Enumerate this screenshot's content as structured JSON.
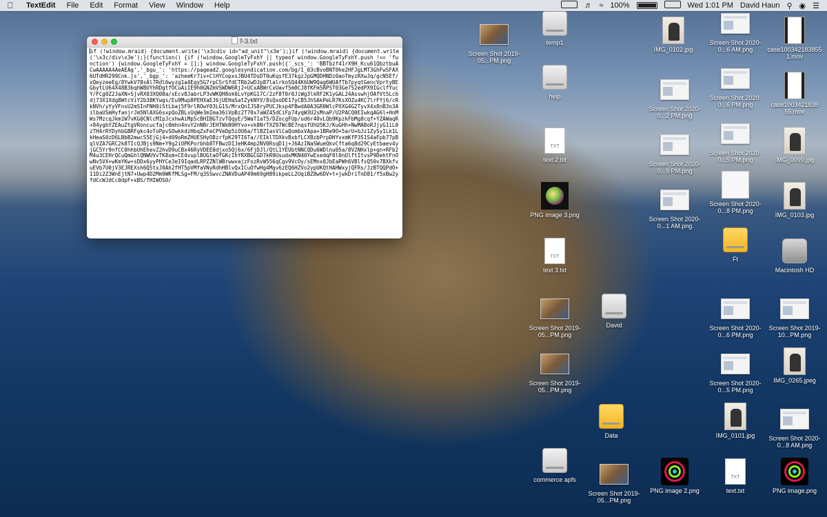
{
  "menubar": {
    "app_name": "TextEdit",
    "menus": [
      "File",
      "Edit",
      "Format",
      "View",
      "Window",
      "Help"
    ],
    "battery": "100%",
    "clock": "Wed 1:01 PM",
    "user": "David Haun"
  },
  "window": {
    "title": "f-3.txt",
    "content": "if (!window.mraid) {document.write('\\x3cdiv id=\"ad_unit\"\\x3e');}if (!window.mraid) {document.write('\\x3c/div\\x3e');}(function() {if (!window.GoogleTyFxhY || typeof window.GoogleTyFxhY.push !== 'function') {window.GoogleTyFxhY = [];} window.GoogleTyFxhY.push({'_scs_': 'BBTbzf41rX9H_Kcu61QbztbuACwAAAAA4AeAEAg','_bgu_': 'https://pagead2.googlesyndication.com/bg/1_03cBvoBNT0he2HFJgLMT3GhFwSFAX6UTdHR299Cnk.js','_bgp_': 'azheeKr7iv+ClHYCopxsJBU4TDsDT0uKqsfE37kgzJpGMQDHNDz0aoTmyzRXwJq/gcN5Ef/xQeyzeeEg/8YwkV78sAl7Rdl6wyzg1a4Eqy5G7rpCSrSfdCTRb2wDJp87lalrkoSQ44K6UW9Qag6WUAfTb7pyqtGencVprtyBEGbytLU64X48B3bqhW8UYhRDgtfOCuAiIE9h0GNZmVSWDW6Rj2+UCxABWrCxUavf5m0CJ8fKFm5RPST03Ge7S2edPX9IGclfYucY/FCg0Z2JaXN+SjvRX03XQ08a/xEcv8JabrLP3vWKQH8ok6LvYpKG17C/2zF8T0r0JiWg3lkRF2K1yGAL24AsswhjOAfVt5Lc6dj73X1Xdg8WtcViY2b38KYwgs/Eu9Mup8PEHXaEJ6jUEHaSatZykNYV/8sQxoDE17yCB5JhSAkPeLR7KsXOZu4KC7lrFYj6/cRkNVh/yYyVFnsU2mSInFNH0iStLbaj5F9rlROwY03LG1S/MrxQnIJS8ryPUCJksp4FBwdA0A3GR0WlcPXXG4G2TyvX4x8nB3o3AilbaUSmHyfanjrJm5NlAXG6sxpQoZBLsUqWe3mIma36iVpBz2T70x7aWZ45dCiFp74yqW3U2sMnaP/U2PACQ0EIwkqAG6l+HnMWs7MzcqJkm1W7vKG0CNlcMIpJcxhwAiMpScBHIBGTzvTQqyE/5WaT1aT5/DZocgFUp/ud6r40vLQb9KpzkFbMg8cqf+YZAWaqR+84ygbYZEAuZtgVRoncucfajc0mhn4nvY2nNBrJEHTWkN9HYvo+vk8NrTXZ97WcBE7nqsfUhU5KJ/KuGHh+NwMABoRJjyG1iL0zTH4rRYDyhbGBRFgkc4oToPpvSOwkkdzHbqZxFeCPVeDp5iOU6a/TlBZIasVlCaQombxVApa+1BRe9O+5arU+bJz1ZySy1Lk1LkHeaS0zD6LBbB2mwcS5EjGj4+d09oRmZHUESHyO8zrfpK29TI6Ta//EIklTDXkvBxbfLCXBzbPrpDHYvxmKfP3S1S4aFpb77pBqlVZA7GRC2k8TIcQJBjs9Nm+Y9g2iOPKPorbhb8TFBwzDIJeHK4mp2NV0RsqD1j+J6AzINaSWueQkvCfta6q8d29CyEtbaev4yjGC5Yr9nfCC0hhbUhEhevZ2hvD9uCBx46RyVDEE0djxo5Qj6x/6FjDJl/QtL1YEUbtNNCQDu6WDlnu05a/8V2NHxlp+gn+RFb2M4u3CEHrQCuQmGhlQNWUVvTK8xm+CE4vuplBUGtaOfGKcIhYRXBGCGD7kR9UsudxMKN40YwEsedqF0l0nUlftItvsP9DehtFnOwNv5VX+wKmYKw+sDDx6yyPHYCe3eI9IqadLRPZZNlWBrwwvajzFozRvW556qCgv9VcOy/sEMnx0JbEaPWh6VBlfsQ50v7BXkfvuEVb7U0jV3EJREXsh6Q5txJ0Ah2fHT5pVMfaVNyRdhHBlvQxICuOfwHg4Mgv6zEQ6HZVo2ypUKQtHAHWxyjQFRs/JzBTQQPdO+11Di2Z3WnEjtN7+Uwp4D2Mm9WKfMLSg+FM/q3SSwvcZNAVDuAP49m69gH89ikpeLL2UqiBZ8w6DV+t+jwkDriTnD81/f5xBw2yfdCcWJdCc0dpF+xBS/fHIWOS0/"
  },
  "desktop_icons": [
    {
      "label": "Screen Shot 2019-05...PM.png",
      "kind": "shot-land"
    },
    {
      "label": "temp1",
      "kind": "drive"
    },
    {
      "label": "IMG_0102.jpg",
      "kind": "photo"
    },
    {
      "label": "Screen Shot 2020-0...6 AM.png",
      "kind": "shot"
    },
    {
      "label": "case100342183855 1.mov",
      "kind": "movie"
    },
    {
      "label": "help",
      "kind": "drive"
    },
    {
      "label": "Screen Shot 2020-0...6 PM.png",
      "kind": "shot"
    },
    {
      "label": "Screen Shot 2020-0...2 PM.png",
      "kind": "shot"
    },
    {
      "label": "case1003421838 55.mov",
      "kind": "movie"
    },
    {
      "label": "text 2.txt",
      "kind": "txt"
    },
    {
      "label": "Screen Shot 2020-0...9 PM.png",
      "kind": "shot"
    },
    {
      "label": "Screen Shot 2020-0...5 PM.png",
      "kind": "shot"
    },
    {
      "label": "IMG_0099.jpg",
      "kind": "photo"
    },
    {
      "label": "PNG image 3.png",
      "kind": "ball"
    },
    {
      "label": "Screen Shot 2020-0...1 AM.png",
      "kind": "shot"
    },
    {
      "label": "Screen Shot 2020-0...8 PM.png",
      "kind": "blank"
    },
    {
      "label": "IMG_0103.jpg",
      "kind": "photo"
    },
    {
      "label": "Ft",
      "kind": "drive-yellow"
    },
    {
      "label": "Macintosh HD",
      "kind": "drive-hd"
    },
    {
      "label": "text 3.txt",
      "kind": "txt"
    },
    {
      "label": "Screen Shot 2019-05...PM.png",
      "kind": "shot-land"
    },
    {
      "label": "David",
      "kind": "drive"
    },
    {
      "label": "Screen Shot 2020-0...6 PM.png",
      "kind": "shot"
    },
    {
      "label": "Screen Shot 2019-10...PM.png",
      "kind": "shot"
    },
    {
      "label": "Screen Shot 2019-05...PM.png",
      "kind": "shot-land"
    },
    {
      "label": "Screen Shot 2020-0...5 PM.png",
      "kind": "shot"
    },
    {
      "label": "IMG_0265.jpeg",
      "kind": "photo"
    },
    {
      "label": "Data",
      "kind": "drive-yellow"
    },
    {
      "label": "IMG_0101.jpg",
      "kind": "photo"
    },
    {
      "label": "Screen Shot 2020-0...8 AM.png",
      "kind": "shot"
    },
    {
      "label": "commerce apfs",
      "kind": "drive"
    },
    {
      "label": "Screen Shot 2019-05...PM.png",
      "kind": "shot-land"
    },
    {
      "label": "PNG image 2.png",
      "kind": "ring"
    },
    {
      "label": "text.txt",
      "kind": "txt"
    },
    {
      "label": "PNG image.png",
      "kind": "ring"
    }
  ]
}
